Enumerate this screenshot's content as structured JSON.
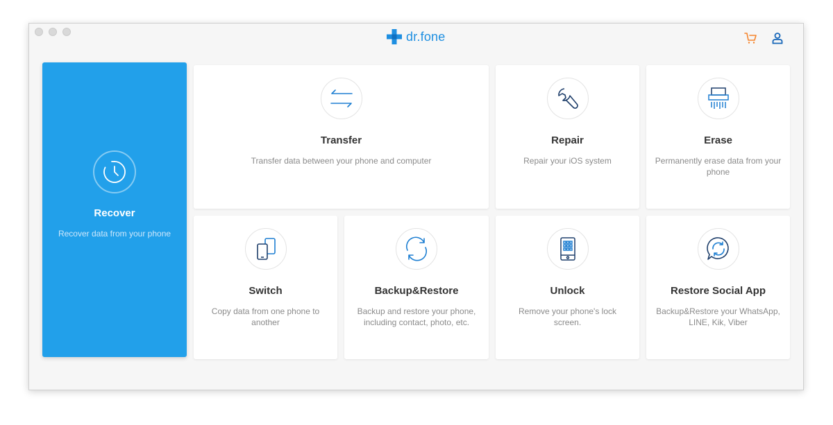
{
  "app": {
    "brand": "dr.fone",
    "brand_color": "#1e8fe1",
    "accent_color": "#22a0ea",
    "cart_icon_color": "#f5842b"
  },
  "header": {
    "icons": [
      "cart-icon",
      "account-icon"
    ]
  },
  "modules": {
    "recover": {
      "title": "Recover",
      "desc": "Recover data from your phone",
      "icon": "clock-icon",
      "active": true
    },
    "transfer": {
      "title": "Transfer",
      "desc": "Transfer data between your phone and computer",
      "icon": "transfer-arrows-icon"
    },
    "repair": {
      "title": "Repair",
      "desc": "Repair your iOS system",
      "icon": "wrench-icon"
    },
    "erase": {
      "title": "Erase",
      "desc": "Permanently erase data from your phone",
      "icon": "shredder-icon"
    },
    "switch": {
      "title": "Switch",
      "desc": "Copy data from one phone to another",
      "icon": "phone-switch-icon"
    },
    "backup": {
      "title": "Backup&Restore",
      "desc": "Backup and restore your phone, including contact, photo, etc.",
      "icon": "sync-icon"
    },
    "unlock": {
      "title": "Unlock",
      "desc": "Remove your phone's lock screen.",
      "icon": "phone-lock-icon"
    },
    "social": {
      "title": "Restore Social App",
      "desc": "Backup&Restore your WhatsApp, LINE, Kik, Viber",
      "icon": "chat-sync-icon"
    }
  }
}
